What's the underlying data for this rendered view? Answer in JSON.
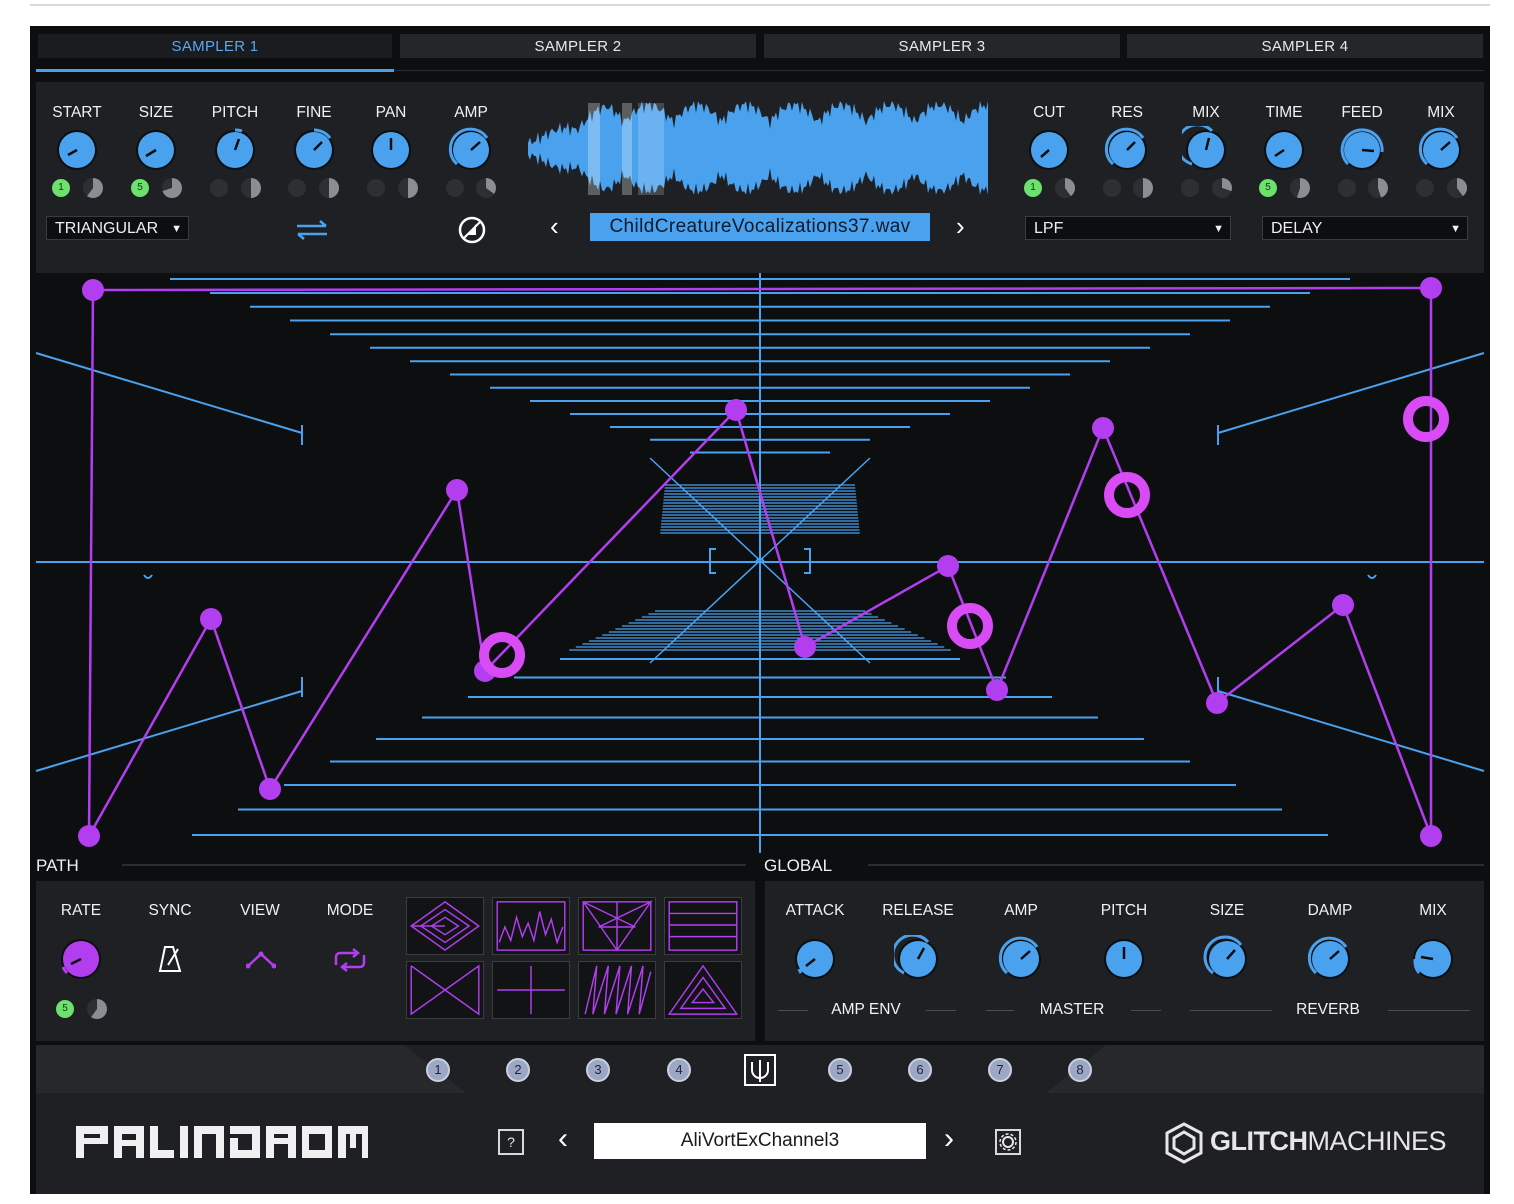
{
  "tabs": [
    "SAMPLER 1",
    "SAMPLER 2",
    "SAMPLER 3",
    "SAMPLER 4"
  ],
  "sampler": {
    "knobs": [
      {
        "label": "START",
        "mod": "1"
      },
      {
        "label": "SIZE",
        "mod": "5"
      },
      {
        "label": "PITCH",
        "mod": ""
      },
      {
        "label": "FINE",
        "mod": ""
      },
      {
        "label": "PAN",
        "mod": ""
      },
      {
        "label": "AMP",
        "mod": ""
      }
    ],
    "window_mode": "TRIANGULAR",
    "sample_file": "ChildCreatureVocalizations37.wav",
    "filter": {
      "knobs": [
        {
          "label": "CUT",
          "mod": "1"
        },
        {
          "label": "RES",
          "mod": ""
        },
        {
          "label": "MIX",
          "mod": ""
        }
      ],
      "type": "LPF"
    },
    "fx": {
      "knobs": [
        {
          "label": "TIME",
          "mod": "5"
        },
        {
          "label": "FEED",
          "mod": ""
        },
        {
          "label": "MIX",
          "mod": ""
        }
      ],
      "type": "DELAY"
    }
  },
  "path": {
    "title": "PATH",
    "controls": [
      "RATE",
      "SYNC",
      "VIEW",
      "MODE"
    ],
    "rate_mod": "5"
  },
  "global": {
    "title": "GLOBAL",
    "knobs": [
      "ATTACK",
      "RELEASE",
      "AMP",
      "PITCH",
      "SIZE",
      "DAMP",
      "MIX"
    ],
    "groups": [
      "AMP ENV",
      "MASTER",
      "REVERB"
    ]
  },
  "slots": [
    "1",
    "2",
    "3",
    "4",
    "5",
    "6",
    "7",
    "8"
  ],
  "footer": {
    "help": "?",
    "preset_name": "AliVortExChannel3",
    "logo": "PALINDROME",
    "brand_bold": "GLITCH",
    "brand_light": "MACHINES"
  },
  "colors": {
    "accent": "#4aa2ef",
    "path": "#b23ef0",
    "mod_on": "#6de06d",
    "panel": "#1e2023"
  }
}
